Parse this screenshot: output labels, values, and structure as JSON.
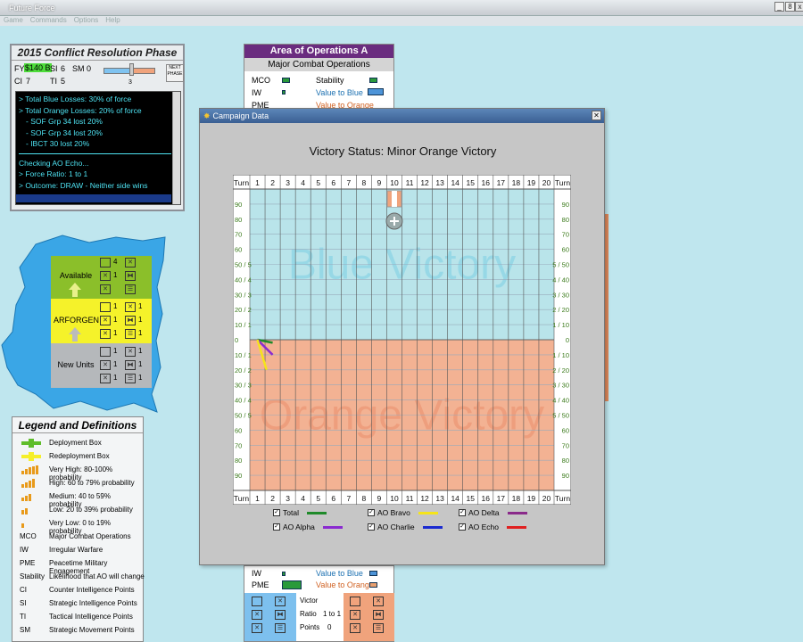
{
  "window": {
    "title": "Future Force",
    "minimize": "_",
    "maximize": "8",
    "close": "x"
  },
  "menu": [
    "Game",
    "Commands",
    "Options",
    "Help"
  ],
  "phase": {
    "title": "2015 Conflict Resolution Phase",
    "fy_label": "FY",
    "fy_value": "$140 B",
    "si_label": "SI",
    "si_value": "6",
    "sm_label": "SM",
    "sm_value": "0",
    "ci_label": "CI",
    "ci_value": "7",
    "ti_label": "TI",
    "ti_value": "5",
    "slider_value": "3",
    "next_button": "NEXT PHASE",
    "log": [
      "> Total Blue Losses: 30% of force",
      "> Total Orange Losses: 20% of force",
      "  - SOF Grp 34 lost 20%",
      "  - SOF Grp 34 lost 20%",
      "  - IBCT 30 lost 20%"
    ],
    "log2": [
      "Checking AO Echo...",
      "> Force Ratio: 1 to 1",
      "> Outcome: DRAW - Neither side wins"
    ]
  },
  "force_pool": {
    "available": "Available",
    "arforgen": "ARFORGEN",
    "new_units": "New Units",
    "available_counts": [
      "4",
      "1"
    ],
    "arforgen_counts": [
      "1",
      "1",
      "1",
      "1",
      "1",
      "1"
    ],
    "new_counts": [
      "1",
      "1",
      "1",
      "1",
      "1",
      "1"
    ]
  },
  "legend": {
    "title": "Legend and Definitions",
    "rows": [
      {
        "key": "",
        "value": "Deployment Box"
      },
      {
        "key": "",
        "value": "Redeployment Box"
      },
      {
        "key": "",
        "value": "Very High: 80-100% probability"
      },
      {
        "key": "",
        "value": "High: 60 to 79% probability"
      },
      {
        "key": "",
        "value": "Medium: 40 to 59% probability"
      },
      {
        "key": "",
        "value": "Low: 20 to 39% probability"
      },
      {
        "key": "",
        "value": "Very Low: 0 to 19% probability"
      },
      {
        "key": "MCO",
        "value": "Major Combat Operations"
      },
      {
        "key": "IW",
        "value": "Irregular Warfare"
      },
      {
        "key": "PME",
        "value": "Peacetime Military Engagement"
      },
      {
        "key": "Stability",
        "value": "Likelihood that AO will change"
      },
      {
        "key": "CI",
        "value": "Counter Intelligence Points"
      },
      {
        "key": "SI",
        "value": "Strategic Intelligence Points"
      },
      {
        "key": "TI",
        "value": "Tactical Intelligence Points"
      },
      {
        "key": "SM",
        "value": "Strategic Movement Points"
      }
    ]
  },
  "ao_a": {
    "title": "Area of Operations A",
    "subtitle": "Major Combat Operations",
    "mco": "MCO",
    "iw": "IW",
    "pme": "PME",
    "stability": "Stability",
    "value_blue": "Value to Blue",
    "value_orange": "Value to Orange"
  },
  "ao_bottom": {
    "iw": "IW",
    "pme": "PME",
    "value_blue": "Value to Blue",
    "value_orange": "Value to Orange",
    "victor": "Victor",
    "ratio_label": "Ratio",
    "ratio_value": "1 to 1",
    "points_label": "Points",
    "points_value": "0"
  },
  "campaign": {
    "title": "Campaign Data",
    "status": "Victory Status: Minor Orange Victory",
    "turn_label": "Turn",
    "blue_watermark": "Blue Victory",
    "orange_watermark": "Orange Victory",
    "colors": {
      "blue_zone": "#b9e4ea",
      "orange_zone": "#f3b293"
    },
    "checkboxes": [
      {
        "label": "Total",
        "color": "#1f8a2a",
        "checked": "✓"
      },
      {
        "label": "AO Bravo",
        "color": "#f5e41a",
        "checked": "✓"
      },
      {
        "label": "AO Delta",
        "color": "#8a2a8a",
        "checked": "✓"
      },
      {
        "label": "AO Alpha",
        "color": "#8a2ad0",
        "checked": "✓"
      },
      {
        "label": "AO Charlie",
        "color": "#1a2ad0",
        "checked": "✓"
      },
      {
        "label": "AO Echo",
        "color": "#e02020",
        "checked": "✓"
      }
    ]
  },
  "chart_data": {
    "type": "line",
    "title": "Victory Status: Minor Orange Victory",
    "x": [
      1,
      2,
      3,
      4,
      5,
      6,
      7,
      8,
      9,
      10,
      11,
      12,
      13,
      14,
      15,
      16,
      17,
      18,
      19,
      20
    ],
    "xlabel": "Turn",
    "y_left_ticks": [
      "90",
      "80",
      "70",
      "60",
      "50 / 5",
      "40 / 4",
      "30 / 3",
      "20 / 2",
      "10 / 1",
      "0",
      "10 / 1",
      "20 / 2",
      "30 / 3",
      "40 / 4",
      "50 / 5",
      "60",
      "70",
      "80",
      "90"
    ],
    "y_right_ticks": [
      "90",
      "80",
      "70",
      "60",
      "5 / 50",
      "4 / 40",
      "3 / 30",
      "2 / 20",
      "1 / 10",
      "0",
      "1 / 10",
      "2 / 20",
      "3 / 30",
      "4 / 40",
      "5 / 50",
      "60",
      "70",
      "80",
      "90"
    ],
    "ylim": [
      -100,
      100
    ],
    "regions": [
      {
        "name": "Blue Victory",
        "from": 0,
        "to": 100
      },
      {
        "name": "Orange Victory",
        "from": -100,
        "to": 0
      }
    ],
    "series": [
      {
        "name": "Total",
        "points": [
          [
            1,
            0
          ],
          [
            2,
            -2
          ]
        ]
      },
      {
        "name": "AO Alpha",
        "points": [
          [
            1,
            0
          ],
          [
            2,
            -10
          ]
        ]
      },
      {
        "name": "AO Bravo",
        "points": [
          [
            1,
            0
          ],
          [
            1.6,
            -20
          ]
        ]
      }
    ],
    "current_turn": 10
  }
}
